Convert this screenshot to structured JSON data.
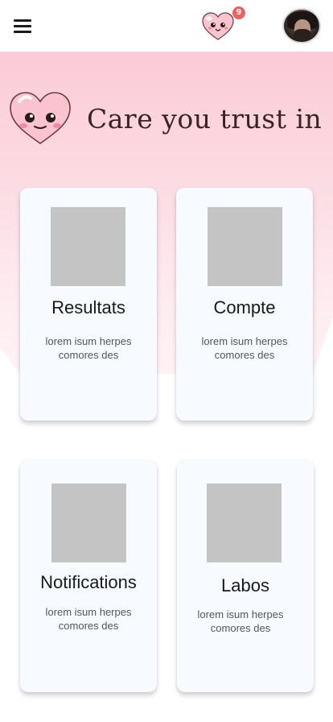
{
  "header": {
    "menu_icon": "hamburger-menu-icon",
    "logo_icon": "kawaii-heart-icon",
    "notification_count": "9",
    "avatar_icon": "user-avatar"
  },
  "hero": {
    "icon": "kawaii-heart-icon",
    "title": "Care you trust in"
  },
  "cards": [
    {
      "title": "Resultats",
      "description": "lorem isum herpes comores des"
    },
    {
      "title": "Compte",
      "description": "lorem isum herpes comores des"
    },
    {
      "title": "Notifications",
      "description": "lorem isum herpes comores des"
    },
    {
      "title": "Labos",
      "description": "lorem isum herpes comores des"
    }
  ],
  "colors": {
    "hero_pink": "#fbcbd7",
    "heart_pink": "#f9c3d0",
    "badge_red": "#f0605f",
    "card_bg": "#f7faff",
    "placeholder_gray": "#c4c4c4",
    "title_brown": "#3a2423"
  }
}
